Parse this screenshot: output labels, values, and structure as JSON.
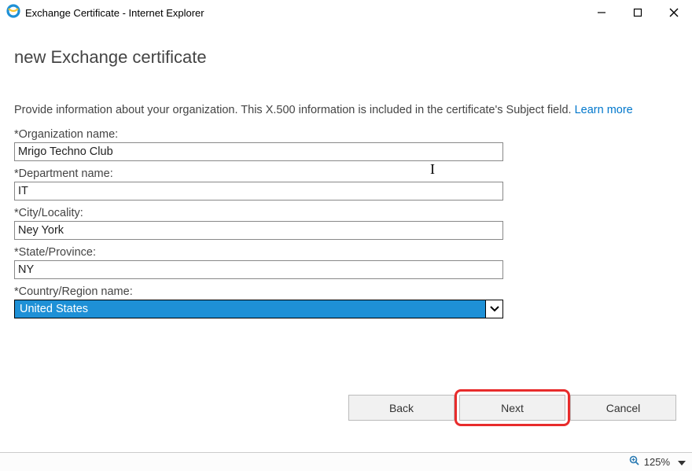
{
  "window": {
    "title": "Exchange Certificate - Internet Explorer"
  },
  "page": {
    "heading": "new Exchange certificate",
    "description": "Provide information about your organization. This X.500 information is included in the certificate's Subject field. ",
    "learn_more": "Learn more"
  },
  "fields": {
    "org": {
      "label": "*Organization name:",
      "value": "Mrigo Techno Club"
    },
    "dept": {
      "label": "*Department name:",
      "value": "IT"
    },
    "city": {
      "label": "*City/Locality:",
      "value": "Ney York"
    },
    "state": {
      "label": "*State/Province:",
      "value": "NY"
    },
    "country": {
      "label": "*Country/Region name:",
      "value": "United States"
    }
  },
  "buttons": {
    "back": "Back",
    "next": "Next",
    "cancel": "Cancel"
  },
  "status": {
    "zoom": "125%"
  }
}
